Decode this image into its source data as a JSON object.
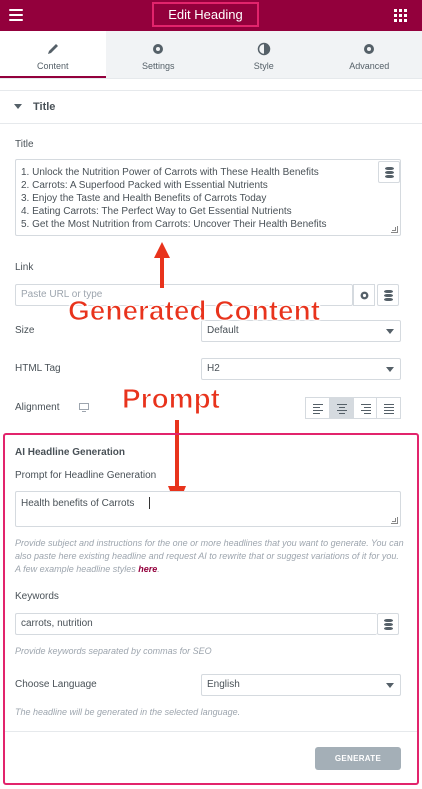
{
  "header": {
    "title": "Edit Heading"
  },
  "tabs": [
    {
      "label": "Content",
      "icon": "pencil-icon"
    },
    {
      "label": "Settings",
      "icon": "gear-icon"
    },
    {
      "label": "Style",
      "icon": "contrast-icon"
    },
    {
      "label": "Advanced",
      "icon": "gear-icon"
    }
  ],
  "section": {
    "title": "Title"
  },
  "title_field": {
    "label": "Title",
    "lines": [
      "1. Unlock the Nutrition Power of Carrots with These Health Benefits",
      "2. Carrots: A Superfood Packed with Essential Nutrients",
      "3. Enjoy the Taste and Health Benefits of Carrots Today",
      "4. Eating Carrots: The Perfect Way to Get Essential Nutrients",
      "5. Get the Most Nutrition from Carrots: Uncover Their Health Benefits"
    ]
  },
  "link_field": {
    "label": "Link",
    "placeholder": "Paste URL or type"
  },
  "size_field": {
    "label": "Size",
    "value": "Default"
  },
  "html_tag_field": {
    "label": "HTML Tag",
    "value": "H2"
  },
  "alignment_field": {
    "label": "Alignment",
    "selected": "center"
  },
  "annotations": {
    "generated": "Generated Content",
    "prompt": "Prompt"
  },
  "ai": {
    "heading": "AI Headline Generation",
    "prompt_label": "Prompt for Headline Generation",
    "prompt_value": "Health benefits of Carrots",
    "prompt_help": "Provide subject and instructions for the one or more headlines that you want to generate. You can also paste here existing headline and request AI to rewrite that or suggest variations of it for you. A few example headline styles",
    "prompt_help_link": "here",
    "keywords_label": "Keywords",
    "keywords_value": "carrots, nutrition",
    "keywords_help": "Provide keywords separated by commas for SEO",
    "language_label": "Choose Language",
    "language_value": "English",
    "language_help": "The headline will be generated in the selected language.",
    "generate_label": "GENERATE"
  },
  "colors": {
    "brand": "#93003c",
    "highlight": "#e2246c",
    "annotation": "#e8331c"
  }
}
